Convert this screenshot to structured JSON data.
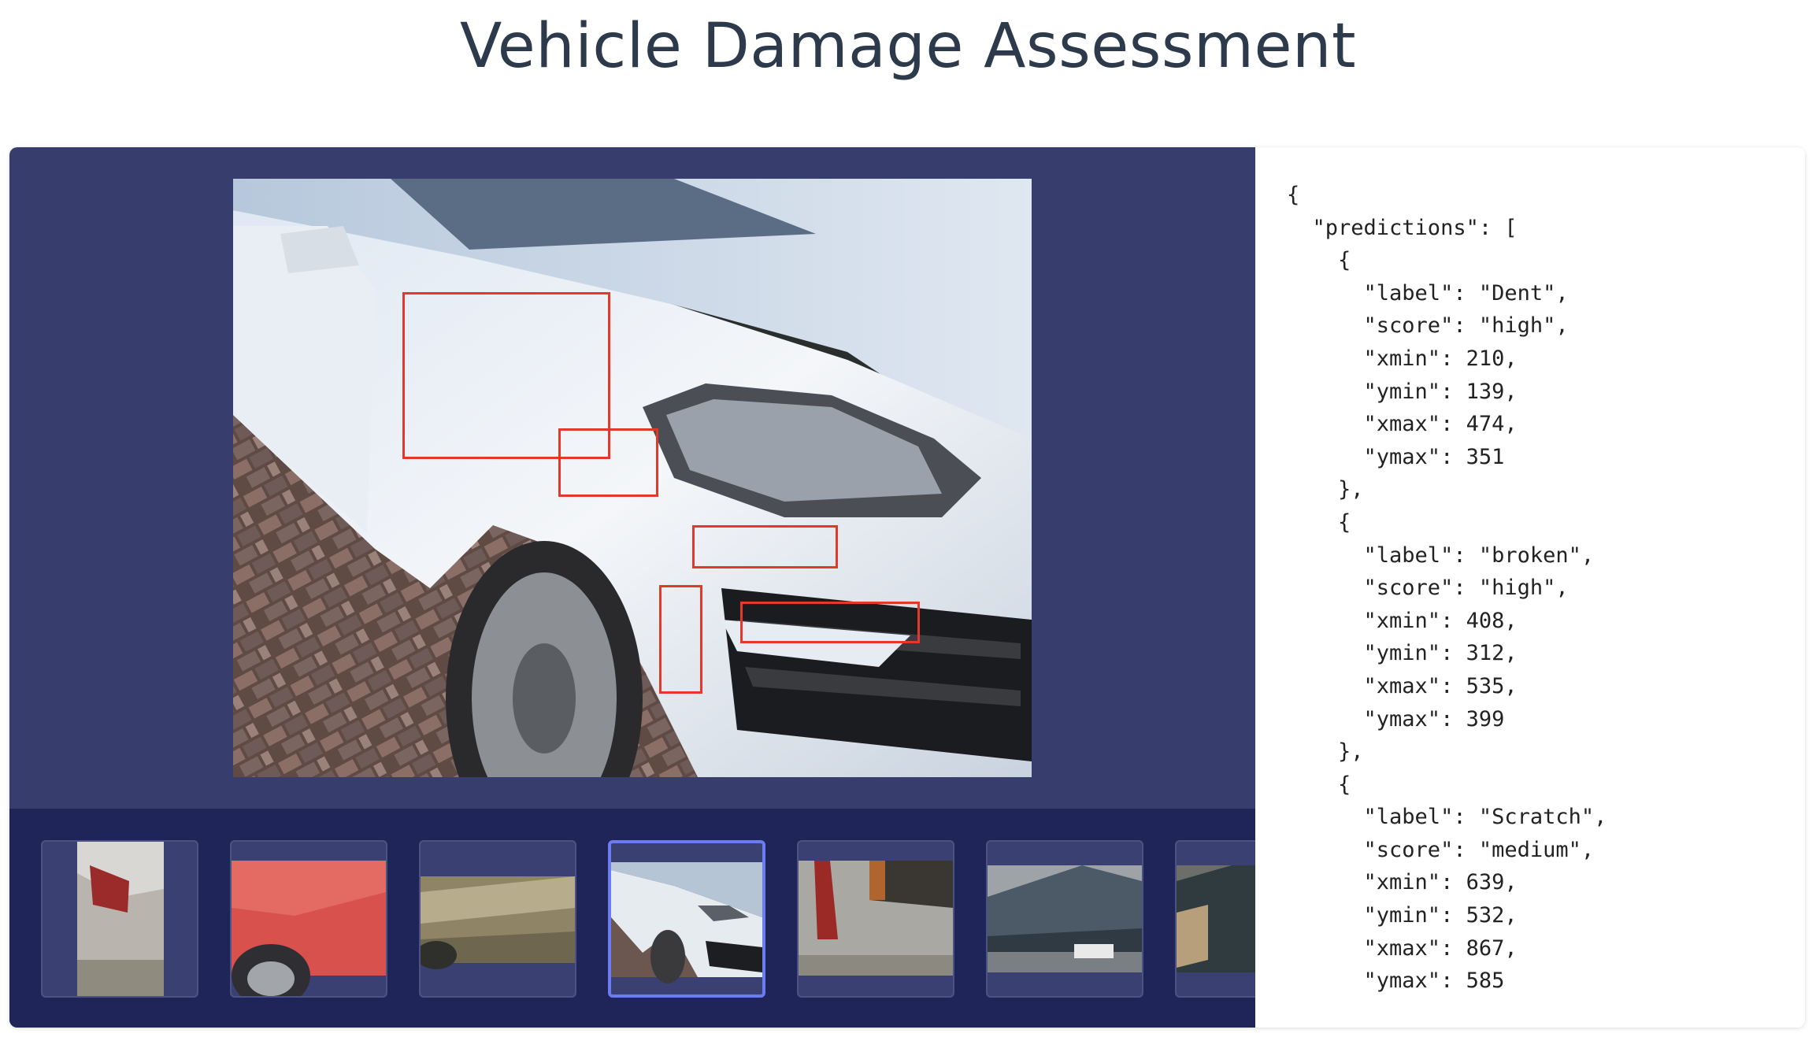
{
  "page": {
    "title": "Vehicle Damage Assessment"
  },
  "colors": {
    "viewer_bg": "#373e6e",
    "strip_bg": "#1f2558",
    "box_stroke": "#e2392b",
    "selected_thumb": "#6b7cf0"
  },
  "thumbnails": [
    {
      "name": "thumbnail-silver-rear",
      "selected": false
    },
    {
      "name": "thumbnail-red-panel",
      "selected": false
    },
    {
      "name": "thumbnail-gold-side",
      "selected": false
    },
    {
      "name": "thumbnail-white-golf",
      "selected": true
    },
    {
      "name": "thumbnail-silver-taillight",
      "selected": false
    },
    {
      "name": "thumbnail-dark-hood",
      "selected": false
    },
    {
      "name": "thumbnail-dark-partial",
      "selected": false
    }
  ],
  "json_output": "{\n  \"predictions\": [\n    {\n      \"label\": \"Dent\",\n      \"score\": \"high\",\n      \"xmin\": 210,\n      \"ymin\": 139,\n      \"xmax\": 474,\n      \"ymax\": 351\n    },\n    {\n      \"label\": \"broken\",\n      \"score\": \"high\",\n      \"xmin\": 408,\n      \"ymin\": 312,\n      \"xmax\": 535,\n      \"ymax\": 399\n    },\n    {\n      \"label\": \"Scratch\",\n      \"score\": \"medium\",\n      \"xmin\": 639,\n      \"ymin\": 532,\n      \"xmax\": 867,\n      \"ymax\": 585"
}
